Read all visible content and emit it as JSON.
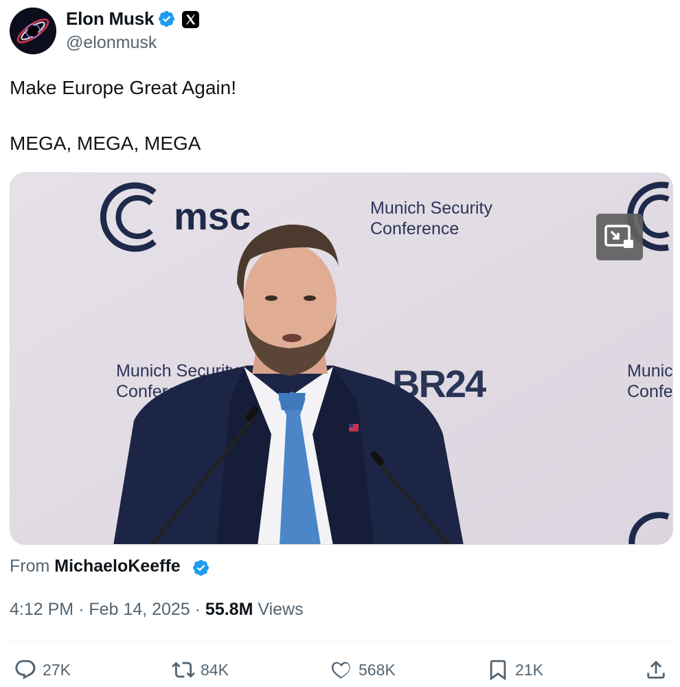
{
  "author": {
    "name": "Elon Musk",
    "handle": "@elonmusk",
    "verified": true,
    "affiliation_icon": "x-logo-icon"
  },
  "tweet": {
    "lines": [
      "Make Europe Great Again!",
      "MEGA, MEGA, MEGA"
    ]
  },
  "media": {
    "type": "video",
    "backdrop_texts": {
      "logo_text": "msc",
      "conference_name": [
        "Munich Security",
        "Conference"
      ],
      "broadcaster": "BR24"
    },
    "pip_icon": "picture-in-picture-icon"
  },
  "attribution": {
    "prefix": "From",
    "username": "MichaeloKeeffe",
    "verified": true
  },
  "meta": {
    "time": "4:12 PM",
    "separator": "·",
    "date": "Feb 14, 2025",
    "views_count": "55.8M",
    "views_label": "Views"
  },
  "actions": {
    "replies": "27K",
    "reposts": "84K",
    "likes": "568K",
    "bookmarks": "21K"
  },
  "colors": {
    "verified_blue": "#1d9bf0",
    "text_primary": "#0f1419",
    "text_secondary": "#536471",
    "backdrop": "#e3dde6",
    "msc_navy": "#1f2a4a",
    "suit": "#1c2545",
    "tie": "#4a86c8"
  }
}
